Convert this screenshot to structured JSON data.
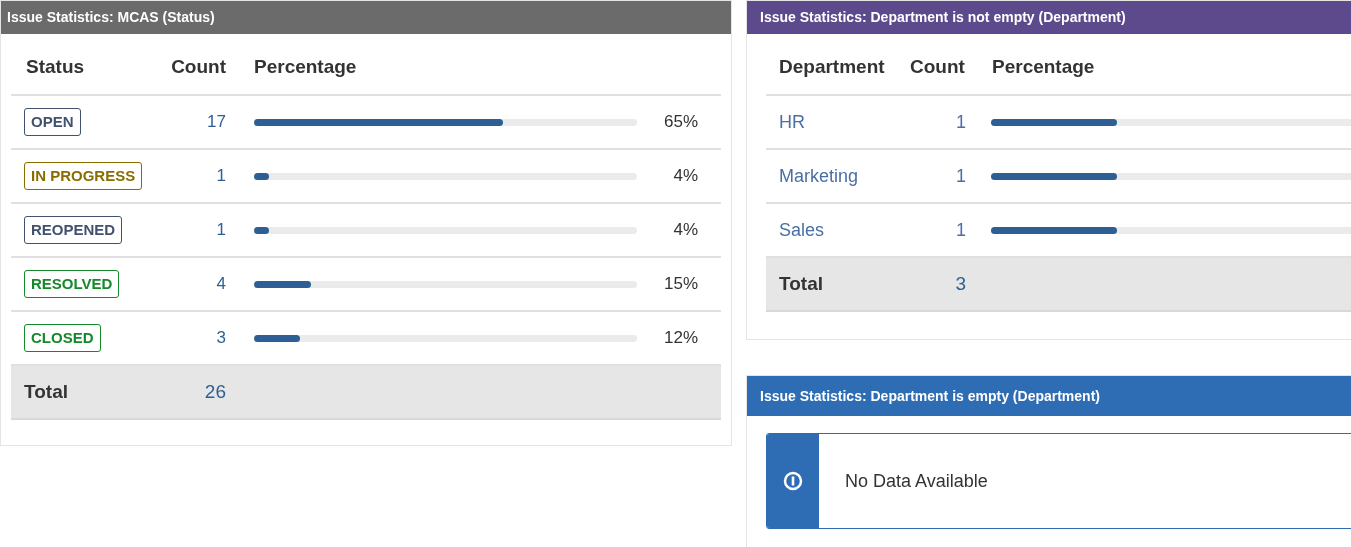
{
  "status_panel": {
    "title": "Issue Statistics: MCAS (Status)",
    "columns": [
      "Status",
      "Count",
      "Percentage"
    ],
    "rows": [
      {
        "status": "OPEN",
        "color": "#42526e",
        "count": "17",
        "level": 0.65,
        "percentage": "65%"
      },
      {
        "status": "IN PROGRESS",
        "color": "#8a6d00",
        "count": "1",
        "level": 0.04,
        "percentage": "4%"
      },
      {
        "status": "REOPENED",
        "color": "#42526e",
        "count": "1",
        "level": 0.04,
        "percentage": "4%"
      },
      {
        "status": "RESOLVED",
        "color": "#14892c",
        "count": "4",
        "level": 0.15,
        "percentage": "15%"
      },
      {
        "status": "CLOSED",
        "color": "#14892c",
        "count": "3",
        "level": 0.12,
        "percentage": "12%"
      }
    ],
    "total": {
      "label": "Total",
      "count": "26"
    }
  },
  "department_panel": {
    "title": "Issue Statistics: Department is not empty (Department)",
    "columns": [
      "Department",
      "Count",
      "Percentage"
    ],
    "rows": [
      {
        "department": "HR",
        "count": "1",
        "level": 0.33
      },
      {
        "department": "Marketing",
        "count": "1",
        "level": 0.33
      },
      {
        "department": "Sales",
        "count": "1",
        "level": 0.33
      }
    ],
    "total": {
      "label": "Total",
      "count": "3"
    }
  },
  "empty_panel": {
    "title": "Issue Statistics: Department is empty (Department)",
    "message": "No Data Available"
  }
}
